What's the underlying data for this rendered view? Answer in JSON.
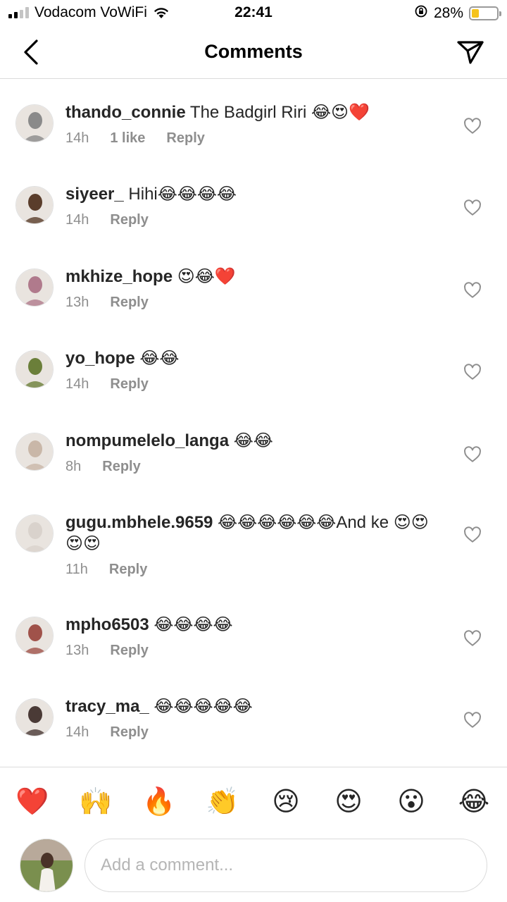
{
  "status_bar": {
    "carrier": "Vodacom VoWiFi",
    "time": "22:41",
    "battery_percent": "28%",
    "battery_level": 0.28,
    "icons": [
      "signal-icon",
      "wifi-icon",
      "orientation-lock-icon",
      "battery-icon"
    ]
  },
  "header": {
    "title": "Comments",
    "back_icon": "chevron-left-icon",
    "send_icon": "paper-plane-icon"
  },
  "comments": [
    {
      "username": "thando_connie",
      "text": " The Badgirl Riri 😂😍❤️",
      "time": "14h",
      "likes": "1 like",
      "reply": "Reply",
      "avatar_color": "#8a8a8a"
    },
    {
      "username": "siyeer_",
      "text": " Hihi😂😂😂😂",
      "time": "14h",
      "likes": "",
      "reply": "Reply",
      "avatar_color": "#5a3d2b"
    },
    {
      "username": "mkhize_hope",
      "text": " 😍😂❤️",
      "time": "13h",
      "likes": "",
      "reply": "Reply",
      "avatar_color": "#b07a8c"
    },
    {
      "username": "yo_hope",
      "text": " 😂😂",
      "time": "14h",
      "likes": "",
      "reply": "Reply",
      "avatar_color": "#6b7f3a"
    },
    {
      "username": "nompumelelo_langa",
      "text": " 😂😂",
      "time": "8h",
      "likes": "",
      "reply": "Reply",
      "avatar_color": "#c9b7a8"
    },
    {
      "username": "gugu.mbhele.9659",
      "text": " 😂😂😂😂😂😂And ke 😍😍😍😍",
      "time": "11h",
      "likes": "",
      "reply": "Reply",
      "avatar_color": "#d9d2cc"
    },
    {
      "username": "mpho6503",
      "text": " 😂😂😂😂",
      "time": "13h",
      "likes": "",
      "reply": "Reply",
      "avatar_color": "#a0524a"
    },
    {
      "username": "tracy_ma_",
      "text": " 😂😂😂😂😂",
      "time": "14h",
      "likes": "",
      "reply": "Reply",
      "avatar_color": "#4a3a36"
    }
  ],
  "emoji_bar": [
    "❤️",
    "🙌",
    "🔥",
    "👏",
    "😢",
    "😍",
    "😮",
    "😂"
  ],
  "composer": {
    "placeholder": "Add a comment...",
    "avatar_color": "#6b5a4a"
  },
  "colors": {
    "text": "#262626",
    "meta": "#8e8e8e",
    "divider": "#dbdbdb",
    "battery": "#f5c31c"
  }
}
